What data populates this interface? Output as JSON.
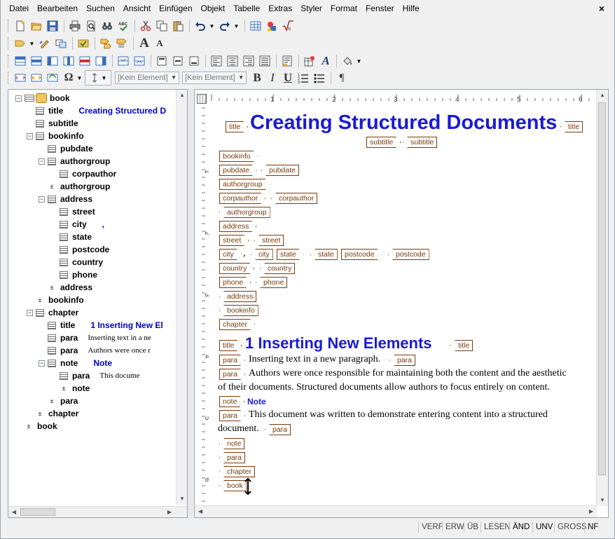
{
  "menubar": {
    "items": [
      "Datei",
      "Bearbeiten",
      "Suchen",
      "Ansicht",
      "Einfügen",
      "Objekt",
      "Tabelle",
      "Extras",
      "Styler",
      "Format",
      "Fenster",
      "Hilfe"
    ],
    "close_label": "×"
  },
  "toolbar": {
    "row1_icons": [
      "new-document-icon",
      "open-folder-icon",
      "save-icon",
      "print-icon",
      "print-preview-icon",
      "find-binoculars-icon",
      "spellcheck-icon",
      "cut-icon",
      "copy-icon",
      "paste-icon",
      "undo-icon",
      "redo-icon",
      "table-grid-icon",
      "insert-image-icon",
      "insert-formula-icon"
    ],
    "row4": {
      "style_combo": "[Kein Element]",
      "style_combo2": "[Kein Element]",
      "bold": "B",
      "italic": "I",
      "underline": "U",
      "pilcrow": "¶",
      "omega": "Ω"
    }
  },
  "tree": {
    "nodes": [
      {
        "toggle": "−",
        "icon": "book",
        "label": "book",
        "value": "",
        "depth": 0
      },
      {
        "toggle": "",
        "icon": "doc",
        "label": "title",
        "value": "Creating Structured D",
        "depth": 1
      },
      {
        "toggle": "",
        "icon": "doc",
        "label": "subtitle",
        "value": "",
        "depth": 1
      },
      {
        "toggle": "−",
        "icon": "doc",
        "label": "bookinfo",
        "value": "",
        "depth": 1
      },
      {
        "toggle": "",
        "icon": "doc",
        "label": "pubdate",
        "value": "",
        "depth": 2
      },
      {
        "toggle": "−",
        "icon": "doc",
        "label": "authorgroup",
        "value": "",
        "depth": 2
      },
      {
        "toggle": "",
        "icon": "doc",
        "label": "corpauthor",
        "value": "",
        "depth": 3
      },
      {
        "toggle": "",
        "icon": "end",
        "label": "authorgroup",
        "value": "",
        "depth": 2
      },
      {
        "toggle": "−",
        "icon": "doc",
        "label": "address",
        "value": "",
        "depth": 2
      },
      {
        "toggle": "",
        "icon": "doc",
        "label": "street",
        "value": "",
        "depth": 3
      },
      {
        "toggle": "",
        "icon": "doc",
        "label": "city",
        "value": ",",
        "depth": 3
      },
      {
        "toggle": "",
        "icon": "doc",
        "label": "state",
        "value": "",
        "depth": 3
      },
      {
        "toggle": "",
        "icon": "doc",
        "label": "postcode",
        "value": "",
        "depth": 3
      },
      {
        "toggle": "",
        "icon": "doc",
        "label": "country",
        "value": "",
        "depth": 3
      },
      {
        "toggle": "",
        "icon": "doc",
        "label": "phone",
        "value": "",
        "depth": 3
      },
      {
        "toggle": "",
        "icon": "end",
        "label": "address",
        "value": "",
        "depth": 2
      },
      {
        "toggle": "",
        "icon": "end",
        "label": "bookinfo",
        "value": "",
        "depth": 1
      },
      {
        "toggle": "−",
        "icon": "doc",
        "label": "chapter",
        "value": "",
        "depth": 1
      },
      {
        "toggle": "",
        "icon": "doc",
        "label": "title",
        "value": "1 Inserting New El",
        "depth": 2
      },
      {
        "toggle": "",
        "icon": "doc",
        "label": "para",
        "value": "Inserting text in a ne",
        "depth": 2,
        "para": true
      },
      {
        "toggle": "",
        "icon": "doc",
        "label": "para",
        "value": "Authors were once r",
        "depth": 2,
        "para": true
      },
      {
        "toggle": "−",
        "icon": "doc",
        "label": "note",
        "value": "Note",
        "depth": 2
      },
      {
        "toggle": "",
        "icon": "doc",
        "label": "para",
        "value": "This docume",
        "depth": 3,
        "para": true
      },
      {
        "toggle": "",
        "icon": "end",
        "label": "note",
        "value": "",
        "depth": 3
      },
      {
        "toggle": "",
        "icon": "end",
        "label": "para",
        "value": "",
        "depth": 2
      },
      {
        "toggle": "",
        "icon": "end",
        "label": "chapter",
        "value": "",
        "depth": 1
      },
      {
        "toggle": "",
        "icon": "end",
        "label": "book",
        "value": "",
        "depth": 0
      }
    ]
  },
  "ruler": {
    "h_numbers": [
      "1",
      "2",
      "3",
      "4",
      "5",
      "6"
    ],
    "v_numbers": [
      "1",
      "2",
      "3",
      "4",
      "5",
      "6"
    ]
  },
  "document": {
    "title_text": "Creating Structured Documents",
    "chapter_title": "1 Inserting New Elements",
    "city_comma": ",",
    "para1": "Inserting text in a new paragraph.",
    "para2_line1": "Authors were once responsible for maintaining both the content and the aesthetic",
    "para2_line2": "of their documents. Structured documents allow authors to focus entirely on content.",
    "note_text": "Note",
    "para3_line1": "This document was written to demonstrate entering content into a structured",
    "para3_line2": "document.",
    "tags": {
      "title": "title",
      "subtitle": "subtitle",
      "bookinfo": "bookinfo",
      "pubdate": "pubdate",
      "authorgroup": "authorgroup",
      "corpauthor": "corpauthor",
      "address": "address",
      "street": "street",
      "city": "city",
      "state": "state",
      "postcode": "postcode",
      "country": "country",
      "phone": "phone",
      "chapter": "chapter",
      "para": "para",
      "note": "note",
      "book": "book"
    }
  },
  "statusbar": {
    "items": [
      "VERF",
      "ERW",
      "ÜB",
      "LESEN",
      "ÄND",
      "UNV",
      "GROSS",
      "NF"
    ]
  },
  "colors": {
    "tag_brown": "#7a3a0b",
    "heading_blue": "#1a1ad6",
    "tree_value_blue": "#0000c8"
  }
}
